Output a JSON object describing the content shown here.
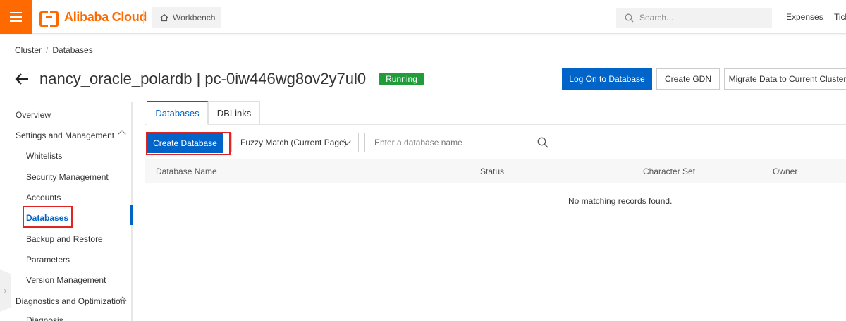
{
  "topbar": {
    "brand": "Alibaba Cloud",
    "workbench": "Workbench",
    "search_placeholder": "Search...",
    "expenses": "Expenses",
    "ticket": "Tick"
  },
  "breadcrumb": {
    "items": [
      "Cluster",
      "Databases"
    ]
  },
  "header": {
    "title": "nancy_oracle_polardb | pc-0iw446wg8ov2y7ul0",
    "status": "Running",
    "actions": {
      "log_on": "Log On to Database",
      "create_gdn": "Create GDN",
      "migrate": "Migrate Data to Current Cluster"
    }
  },
  "sidebar": {
    "items": [
      {
        "label": "Overview"
      },
      {
        "label": "Settings and Management"
      },
      {
        "label": "Whitelists"
      },
      {
        "label": "Security Management"
      },
      {
        "label": "Accounts"
      },
      {
        "label": "Databases"
      },
      {
        "label": "Backup and Restore"
      },
      {
        "label": "Parameters"
      },
      {
        "label": "Version Management"
      },
      {
        "label": "Diagnostics and Optimization"
      },
      {
        "label": "Diagnosis"
      }
    ]
  },
  "tabs": [
    {
      "label": "Databases"
    },
    {
      "label": "DBLinks"
    }
  ],
  "toolbar": {
    "create_label": "Create Database",
    "match_mode": "Fuzzy Match (Current Page)",
    "search_placeholder": "Enter a database name"
  },
  "table": {
    "columns": [
      "Database Name",
      "Status",
      "Character Set",
      "Owner"
    ],
    "empty_message": "No matching records found."
  },
  "colors": {
    "brand": "#ff6a00",
    "primary": "#0064c8",
    "running": "#219c3a",
    "highlight": "#e02424"
  }
}
